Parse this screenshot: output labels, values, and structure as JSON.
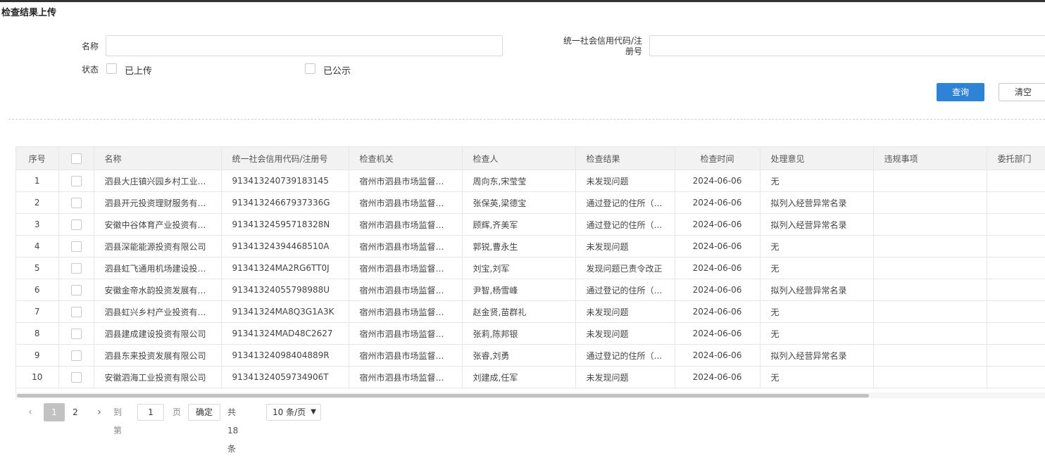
{
  "page": {
    "title": "检查结果上传"
  },
  "search": {
    "name_label": "名称",
    "name_value": "",
    "name_placeholder": "",
    "code_label_line1": "统一社会信用代码/注",
    "code_label_line2": "册号",
    "code_value": "",
    "code_placeholder": "",
    "status_label": "状态",
    "status_options": [
      {
        "label": "已上传",
        "checked": false
      },
      {
        "label": "已公示",
        "checked": false
      }
    ],
    "query_button": "查询",
    "clear_button": "清空"
  },
  "table": {
    "headers": [
      "序号",
      "",
      "名称",
      "统一社会信用代码/注册号",
      "检查机关",
      "检查人",
      "检查结果",
      "检查时间",
      "处理意见",
      "违规事项",
      "委托部门"
    ],
    "rows": [
      {
        "index": "1",
        "name": "泗县大庄镇兴园乡村工业…",
        "code": "913413240739183145",
        "authority": "宿州市泗县市场监督管…",
        "inspector": "周向东,宋莹莹",
        "result": "未发现问题",
        "date": "2024-06-06",
        "opinion": "无",
        "violation": "",
        "dept": ""
      },
      {
        "index": "2",
        "name": "泗县开元投资理财服务有…",
        "code": "91341324667937336G",
        "authority": "宿州市泗县市场监督管…",
        "inspector": "张保英,梁德宝",
        "result": "通过登记的住所（…",
        "date": "2024-06-06",
        "opinion": "拟列入经营异常名录",
        "violation": "",
        "dept": ""
      },
      {
        "index": "3",
        "name": "安徽中谷体育产业投资有…",
        "code": "91341324595718328N",
        "authority": "宿州市泗县市场监督管…",
        "inspector": "顾辉,齐美军",
        "result": "通过登记的住所（…",
        "date": "2024-06-06",
        "opinion": "拟列入经营异常名录",
        "violation": "",
        "dept": ""
      },
      {
        "index": "4",
        "name": "泗县深能能源投资有限公司",
        "code": "91341324394468510A",
        "authority": "宿州市泗县市场监督管…",
        "inspector": "郭锐,曹永生",
        "result": "未发现问题",
        "date": "2024-06-06",
        "opinion": "无",
        "violation": "",
        "dept": ""
      },
      {
        "index": "5",
        "name": "泗县虹飞通用机场建设投…",
        "code": "91341324MA2RG6TT0J",
        "authority": "宿州市泗县市场监督管…",
        "inspector": "刘宝,刘军",
        "result": "发现问题已责令改正",
        "date": "2024-06-06",
        "opinion": "无",
        "violation": "",
        "dept": ""
      },
      {
        "index": "6",
        "name": "安徽金帝水韵投资发展有…",
        "code": "9134132405579898​8U",
        "authority": "宿州市泗县市场监督管…",
        "inspector": "尹智,杨雪峰",
        "result": "通过登记的住所（…",
        "date": "2024-06-06",
        "opinion": "拟列入经营异常名录",
        "violation": "",
        "dept": ""
      },
      {
        "index": "7",
        "name": "泗县虹兴乡村产业投资有…",
        "code": "91341324MA8Q3G1A3K",
        "authority": "宿州市泗县市场监督管…",
        "inspector": "赵金贤,苗群礼",
        "result": "未发现问题",
        "date": "2024-06-06",
        "opinion": "无",
        "violation": "",
        "dept": ""
      },
      {
        "index": "8",
        "name": "泗县建成建设投资有限公司",
        "code": "91341324MAD48C2627",
        "authority": "宿州市泗县市场监督管…",
        "inspector": "张莉,陈邦银",
        "result": "未发现问题",
        "date": "2024-06-06",
        "opinion": "无",
        "violation": "",
        "dept": ""
      },
      {
        "index": "9",
        "name": "泗县东来投资发展有限公司",
        "code": "91341324098404889R",
        "authority": "宿州市泗县市场监督管…",
        "inspector": "张睿,刘勇",
        "result": "通过登记的住所（…",
        "date": "2024-06-06",
        "opinion": "拟列入经营异常名录",
        "violation": "",
        "dept": ""
      },
      {
        "index": "10",
        "name": "安徽泗海工业投资有限公司",
        "code": "91341324059734906T",
        "authority": "宿州市泗县市场监督管…",
        "inspector": "刘建成,任军",
        "result": "未发现问题",
        "date": "2024-06-06",
        "opinion": "无",
        "violation": "",
        "dept": ""
      }
    ]
  },
  "pager": {
    "prev_icon": "chevron-left-icon",
    "next_icon": "chevron-right-icon",
    "pages": [
      "1",
      "2"
    ],
    "current_page": "1",
    "goto_label": "到第",
    "goto_value": "1",
    "page_unit": "页",
    "confirm": "确定",
    "total": "共 18 条",
    "page_size": "10 条/页"
  },
  "colors": {
    "primary": "#2f83d6",
    "header_bg": "#f2f2f2",
    "border": "#e6e6e6"
  }
}
